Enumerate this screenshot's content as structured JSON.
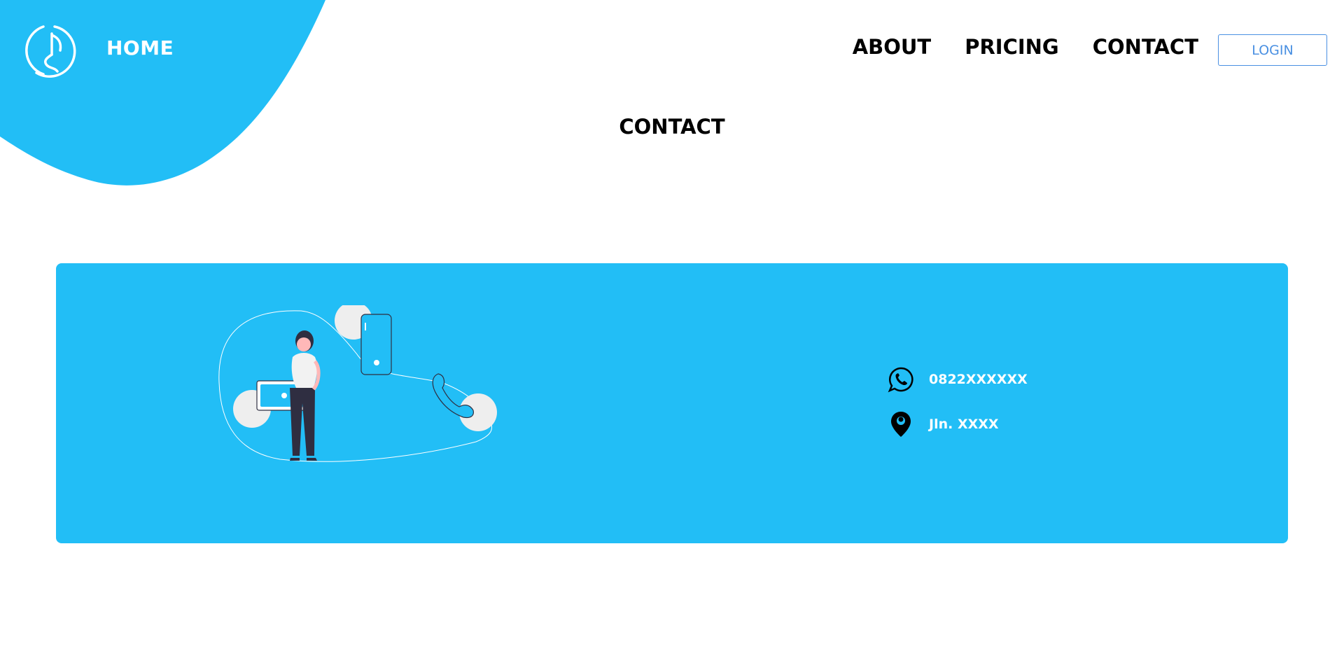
{
  "header": {
    "home_label": "HOME",
    "logo_icon": "music-note-circle-icon",
    "nav": [
      {
        "label": "ABOUT"
      },
      {
        "label": "PRICING"
      },
      {
        "label": "CONTACT"
      }
    ],
    "login_label": "LOGIN"
  },
  "main": {
    "title": "CONTACT",
    "contact": {
      "phone": "0822XXXXXX",
      "phone_icon": "whatsapp-icon",
      "address": "Jln. XXXX",
      "address_icon": "location-pin-icon"
    }
  },
  "colors": {
    "accent": "#22bef6",
    "login_border": "#4a90e2",
    "text": "#000000"
  }
}
